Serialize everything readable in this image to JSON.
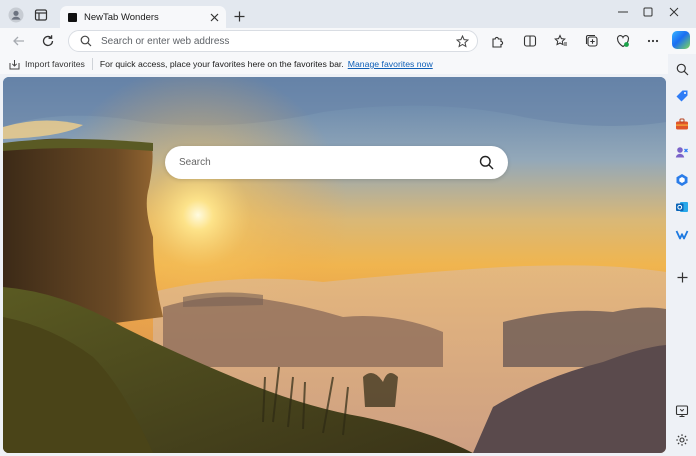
{
  "tab": {
    "title": "NewTab Wonders"
  },
  "address_bar": {
    "placeholder": "Search or enter web address"
  },
  "favorites_bar": {
    "import_label": "Import favorites",
    "message": "For quick access, place your favorites here on the favorites bar.",
    "manage_link": "Manage favorites now"
  },
  "newtab_page": {
    "search_placeholder": "Search"
  },
  "colors": {
    "accent_link": "#0f5fb7",
    "tab_strip": "#e3e8ef",
    "toolbar": "#f7f8fa"
  },
  "icons": {
    "sidebar": [
      "search-icon",
      "tag-icon",
      "tools-icon",
      "games-icon",
      "microsoft365-icon",
      "outlook-icon",
      "drop-icon",
      "add-icon",
      "split-screen-icon",
      "settings-icon"
    ]
  }
}
